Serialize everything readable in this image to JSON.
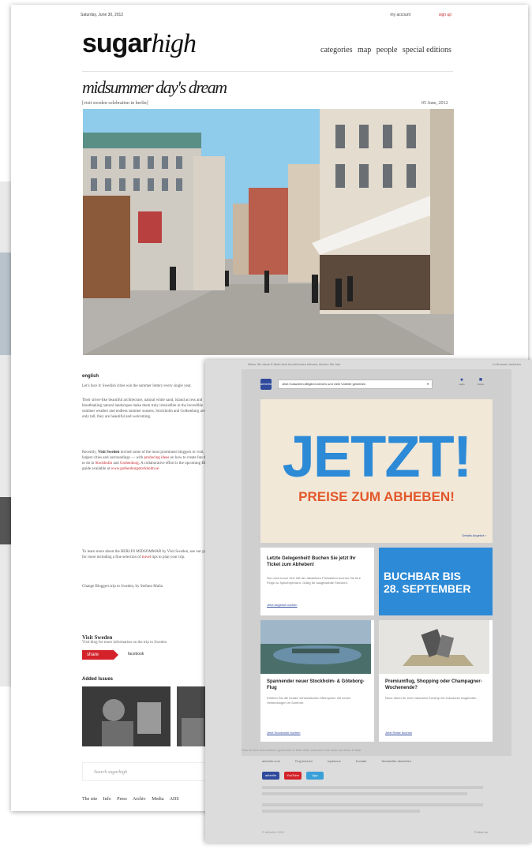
{
  "blog": {
    "topbar": {
      "date": "Saturday, June 30, 2012",
      "my_account": "my account",
      "sign_up": "sign up"
    },
    "logo": {
      "part1": "sugar",
      "part2": "high"
    },
    "nav": [
      "categories",
      "map",
      "people",
      "special editions"
    ],
    "post": {
      "title": "midsummer day's dream",
      "subtitle": "[visit sweden celebration in berlin]",
      "date": "05 June, 2012",
      "language": "english",
      "p1": "Let's face it: Swedish cities win the summer lottery every single year.",
      "p2": "Their silver-like beautiful architecture, natural white sand, island access and breathtaking natural landscapes make them truly irresistible in the incredible summer weather and endless summer sunsets. Stockholm and Gothenburg are not only tall, they are beautiful and welcoming.",
      "p3a": "Recently,",
      "p3_bold": "Visit Sweden",
      "p3b": "invited some of the most prominent bloggers to visit, the largest cities and surroundings — with",
      "p3_red1": "producing ideas",
      "p3c": "on how to create fun things to do in",
      "p3_red2": "Stockholm",
      "p3d": "and",
      "p3_red3": "Gothenburg",
      "p3e": ". A collaborative effort is the upcoming BERLIN guide available at",
      "p3_red4": "www.gothenburgstockholm.se",
      "p4a": "To learn more about the BERLIN MIDSOMMAR by Visit Sweden, see our guide for more including a fine selection of",
      "p4_red": "travel",
      "p4b": "tips to plan your trip.",
      "p5": "Change Bloggers trip to Sweden, by Stefano Malia"
    },
    "visit": {
      "title": "Visit Sweden",
      "sub": "Visit blog for more information on the trip to Sweden",
      "share": "share",
      "facebook": "facebook"
    },
    "added_label": "Added Issues",
    "search_placeholder": "Search sugarhigh",
    "footer": [
      "The site",
      "Info",
      "Press",
      "Archiv",
      "Media",
      "ADS"
    ]
  },
  "news": {
    "top_left": "Wenn Sie diese E-Mail nicht korrekt lesen können, klicken Sie hier",
    "top_right": "In Browser ansehen",
    "logo": "airberlin",
    "select": "Jetzt Gutschein-Mitglied werden und viele Vorteile genießen",
    "icon1": "Login",
    "icon2": "Konto",
    "jetzt": "JETZT!",
    "preise": "PREISE ZUM ABHEBEN!",
    "hero_link": "Details Angebot",
    "card1": {
      "title": "Letzte Gelegenheit! Buchen Sie jetzt Ihr Ticket zum Abheben!",
      "text": "Nur noch kurze Zeit: Mit der attraktiven Preisaktion buchen Sie Ihre Flüge zu Spitzenpreisen. Gültig für ausgewählte Strecken.",
      "link": "Jetzt Angebot buchen"
    },
    "blue": {
      "l1": "BUCHBAR BIS",
      "l2": "28. SEPTEMBER"
    },
    "card2": {
      "title": "Spannender neuer Stockholm- & Göteborg-Flug",
      "text": "Erleben Sie die beiden schwedischen Metropolen mit neuen Verbindungen im Sommer.",
      "link": "Jetzt Stockholm buchen"
    },
    "card3": {
      "title": "Premiumflug, Shopping oder Champagner-Wochenende?",
      "text": "Neue Ideen für Ihren nächsten Kurztrip mit exklusiven Angeboten.",
      "link": "Jetzt Reise buchen"
    },
    "foot_links": [
      "airberlin.com",
      "Flug buchen",
      "topbonus",
      "Kontakt",
      "Newsletter abmelden"
    ],
    "badges": [
      "airberlin",
      "YouTube",
      "App"
    ],
    "foot_note": "Dies ist eine automatisch generierte E-Mail. Bitte antworten Sie nicht auf diese E-Mail.",
    "bottom_left": "© airberlin 2012",
    "bottom_right": "Follow us"
  },
  "colors": {
    "accent_red": "#c2272d",
    "news_blue": "#2d8ad6",
    "news_orange": "#e2572a",
    "navy": "#2f4a9c"
  }
}
